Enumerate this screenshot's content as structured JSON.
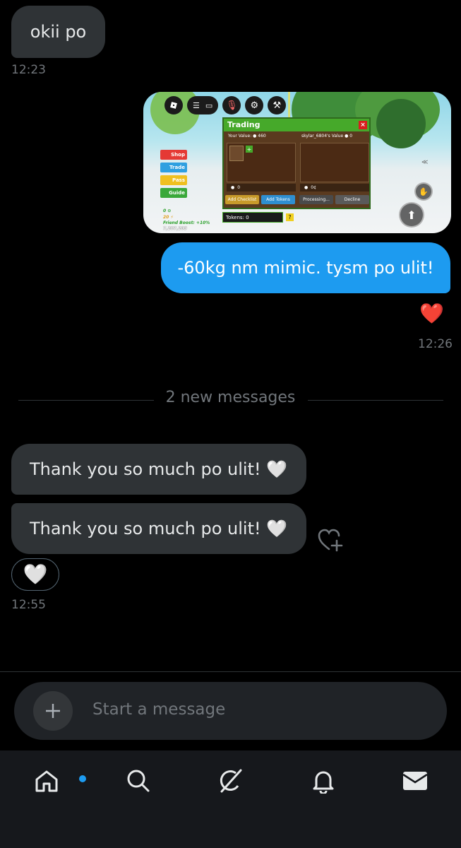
{
  "messages": {
    "m1": {
      "text": "okii po",
      "time": "12:23"
    },
    "m2": {
      "text": "-60kg nm mimic. tysm po ulit!",
      "time": "12:26",
      "reaction": "❤️"
    },
    "divider": "2 new messages",
    "m3": {
      "text": "Thank you so much po ulit! 🤍"
    },
    "m4": {
      "text": "Thank you so much po ulit! 🤍",
      "reaction": "🤍",
      "time": "12:55"
    }
  },
  "screenshot": {
    "trading_title": "Trading",
    "your_value_label": "Your Value:",
    "your_value": "460",
    "their_value_label": "skylar_6804's Value",
    "their_value": "0",
    "your_tokens": "0",
    "their_tokens": "0¢",
    "add_checklist": "Add Checklist",
    "add_tokens": "Add Tokens",
    "processing": "Processing...",
    "decline": "Decline",
    "tokens_label": "Tokens: 0",
    "side_menu": [
      "Shop",
      "Trade",
      "Pass",
      "Guide"
    ],
    "side_info": [
      "0 ⊙",
      "20 ⚡",
      "Friend Boost: +10%",
      "7,207,203"
    ]
  },
  "composer": {
    "placeholder": "Start a message"
  },
  "colors": {
    "accent": "#1d9bf0",
    "bubble_in": "#2f3336",
    "background": "#000000"
  },
  "nav": {
    "items": [
      "home-icon",
      "search-icon",
      "grok-icon",
      "notifications-icon",
      "messages-icon"
    ]
  }
}
